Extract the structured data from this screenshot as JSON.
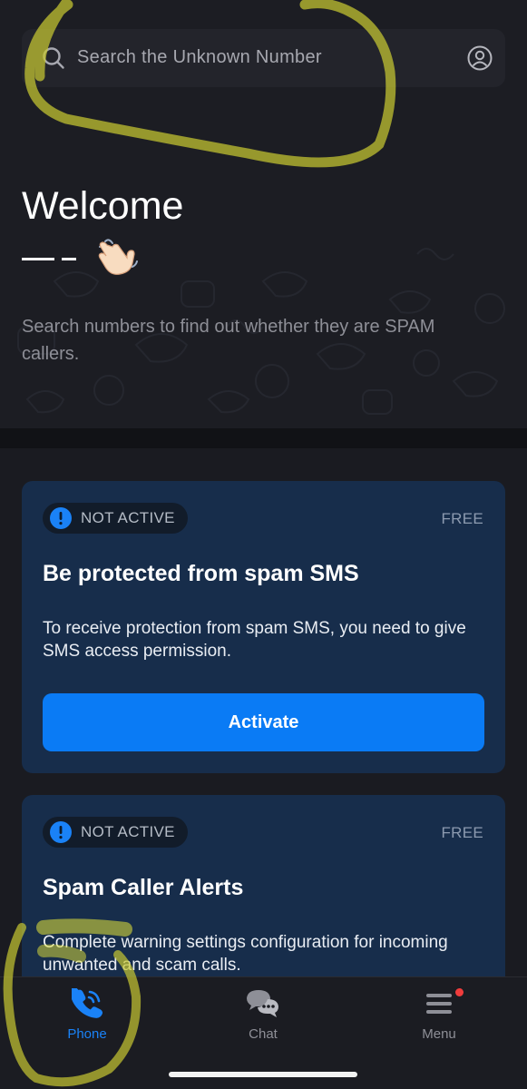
{
  "search": {
    "placeholder": "Search the Unknown Number"
  },
  "hero": {
    "title": "Welcome",
    "subtitle": "Search numbers to find out whether they are SPAM callers."
  },
  "cards": [
    {
      "status": "NOT ACTIVE",
      "price": "FREE",
      "title": "Be protected from spam SMS",
      "description": "To receive protection from spam SMS, you need to give SMS access permission.",
      "button": "Activate"
    },
    {
      "status": "NOT ACTIVE",
      "price": "FREE",
      "title": "Spam Caller Alerts",
      "description": "Complete warning settings configuration for incoming unwanted and scam calls."
    }
  ],
  "nav": {
    "items": [
      {
        "label": "Phone",
        "icon": "phone-icon",
        "active": true
      },
      {
        "label": "Chat",
        "icon": "chat-icon",
        "active": false
      },
      {
        "label": "Menu",
        "icon": "menu-icon",
        "active": false,
        "notification_dot": true
      }
    ]
  },
  "colors": {
    "background": "#1a1b21",
    "card": "#172d4b",
    "accent": "#0a7bf5",
    "active_nav": "#1a82f7",
    "badge_icon": "#1a82f7",
    "notification": "#f03c3c",
    "highlight_marker": "#c8c832"
  }
}
